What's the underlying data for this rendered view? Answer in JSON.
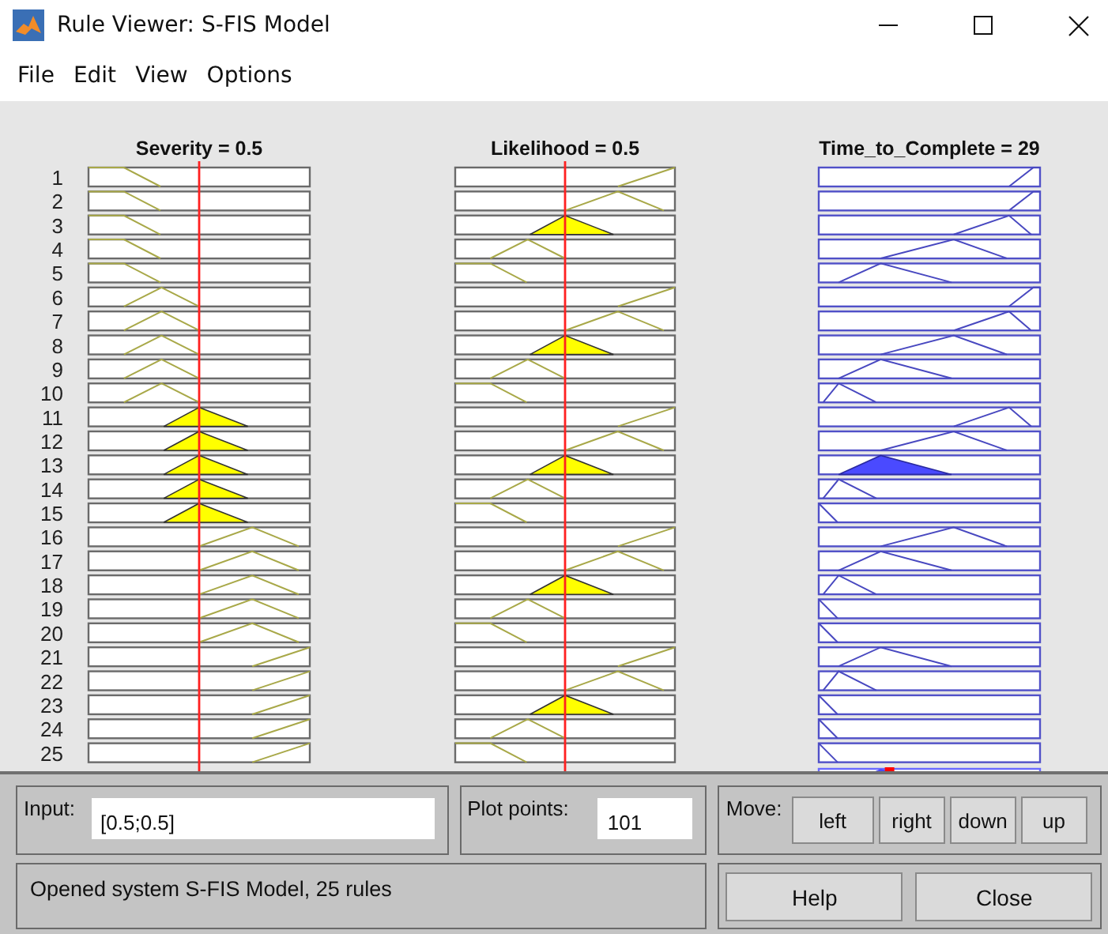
{
  "window": {
    "title": "Rule Viewer: S-FIS Model"
  },
  "menu": [
    "File",
    "Edit",
    "View",
    "Options"
  ],
  "columns": [
    {
      "title": "Severity = 0.5",
      "kind": "input",
      "level": 0.5
    },
    {
      "title": "Likelihood = 0.5",
      "kind": "input",
      "level": 0.5
    },
    {
      "title": "Time_to_Complete = 29",
      "kind": "output",
      "level": 0.32
    }
  ],
  "rules": [
    {
      "number": "1",
      "cells": [
        {
          "kind": "low",
          "fired": false
        },
        {
          "kind": "high",
          "fired": false
        },
        {
          "kind": "vlong",
          "fired": false
        }
      ]
    },
    {
      "number": "2",
      "cells": [
        {
          "kind": "low",
          "fired": false
        },
        {
          "kind": "midhigh",
          "fired": false
        },
        {
          "kind": "vlong",
          "fired": false
        }
      ]
    },
    {
      "number": "3",
      "cells": [
        {
          "kind": "low",
          "fired": false
        },
        {
          "kind": "mid",
          "fired": true
        },
        {
          "kind": "long",
          "fired": false
        }
      ]
    },
    {
      "number": "4",
      "cells": [
        {
          "kind": "low",
          "fired": false
        },
        {
          "kind": "midlow",
          "fired": false
        },
        {
          "kind": "medium",
          "fired": false
        }
      ]
    },
    {
      "number": "5",
      "cells": [
        {
          "kind": "low",
          "fired": false
        },
        {
          "kind": "low",
          "fired": false
        },
        {
          "kind": "short",
          "fired": false
        }
      ]
    },
    {
      "number": "6",
      "cells": [
        {
          "kind": "midlow",
          "fired": false
        },
        {
          "kind": "high",
          "fired": false
        },
        {
          "kind": "vlong",
          "fired": false
        }
      ]
    },
    {
      "number": "7",
      "cells": [
        {
          "kind": "midlow",
          "fired": false
        },
        {
          "kind": "midhigh",
          "fired": false
        },
        {
          "kind": "long",
          "fired": false
        }
      ]
    },
    {
      "number": "8",
      "cells": [
        {
          "kind": "midlow",
          "fired": false
        },
        {
          "kind": "mid",
          "fired": true
        },
        {
          "kind": "medium",
          "fired": false
        }
      ]
    },
    {
      "number": "9",
      "cells": [
        {
          "kind": "midlow",
          "fired": false
        },
        {
          "kind": "midlow",
          "fired": false
        },
        {
          "kind": "short",
          "fired": false
        }
      ]
    },
    {
      "number": "10",
      "cells": [
        {
          "kind": "midlow",
          "fired": false
        },
        {
          "kind": "low",
          "fired": false
        },
        {
          "kind": "vshort",
          "fired": false
        }
      ]
    },
    {
      "number": "11",
      "cells": [
        {
          "kind": "mid",
          "fired": true
        },
        {
          "kind": "high",
          "fired": false
        },
        {
          "kind": "long",
          "fired": false
        }
      ]
    },
    {
      "number": "12",
      "cells": [
        {
          "kind": "mid",
          "fired": true
        },
        {
          "kind": "midhigh",
          "fired": false
        },
        {
          "kind": "medium",
          "fired": false
        }
      ]
    },
    {
      "number": "13",
      "cells": [
        {
          "kind": "mid",
          "fired": true
        },
        {
          "kind": "mid",
          "fired": true
        },
        {
          "kind": "short",
          "fired": true
        }
      ]
    },
    {
      "number": "14",
      "cells": [
        {
          "kind": "mid",
          "fired": true
        },
        {
          "kind": "midlow",
          "fired": false
        },
        {
          "kind": "vshort",
          "fired": false
        }
      ]
    },
    {
      "number": "15",
      "cells": [
        {
          "kind": "mid",
          "fired": true
        },
        {
          "kind": "low",
          "fired": false
        },
        {
          "kind": "edge",
          "fired": false
        }
      ]
    },
    {
      "number": "16",
      "cells": [
        {
          "kind": "midhigh",
          "fired": false
        },
        {
          "kind": "high",
          "fired": false
        },
        {
          "kind": "medium",
          "fired": false
        }
      ]
    },
    {
      "number": "17",
      "cells": [
        {
          "kind": "midhigh",
          "fired": false
        },
        {
          "kind": "midhigh",
          "fired": false
        },
        {
          "kind": "short",
          "fired": false
        }
      ]
    },
    {
      "number": "18",
      "cells": [
        {
          "kind": "midhigh",
          "fired": false
        },
        {
          "kind": "mid",
          "fired": true
        },
        {
          "kind": "vshort",
          "fired": false
        }
      ]
    },
    {
      "number": "19",
      "cells": [
        {
          "kind": "midhigh",
          "fired": false
        },
        {
          "kind": "midlow",
          "fired": false
        },
        {
          "kind": "edge",
          "fired": false
        }
      ]
    },
    {
      "number": "20",
      "cells": [
        {
          "kind": "midhigh",
          "fired": false
        },
        {
          "kind": "low",
          "fired": false
        },
        {
          "kind": "edge",
          "fired": false
        }
      ]
    },
    {
      "number": "21",
      "cells": [
        {
          "kind": "high",
          "fired": false
        },
        {
          "kind": "high",
          "fired": false
        },
        {
          "kind": "short",
          "fired": false
        }
      ]
    },
    {
      "number": "22",
      "cells": [
        {
          "kind": "high",
          "fired": false
        },
        {
          "kind": "midhigh",
          "fired": false
        },
        {
          "kind": "vshort",
          "fired": false
        }
      ]
    },
    {
      "number": "23",
      "cells": [
        {
          "kind": "high",
          "fired": false
        },
        {
          "kind": "mid",
          "fired": true
        },
        {
          "kind": "edge",
          "fired": false
        }
      ]
    },
    {
      "number": "24",
      "cells": [
        {
          "kind": "high",
          "fired": false
        },
        {
          "kind": "midlow",
          "fired": false
        },
        {
          "kind": "edge",
          "fired": false
        }
      ]
    },
    {
      "number": "25",
      "cells": [
        {
          "kind": "high",
          "fired": false
        },
        {
          "kind": "low",
          "fired": false
        },
        {
          "kind": "edge",
          "fired": false
        }
      ]
    }
  ],
  "input": {
    "label": "Input:",
    "value": "[0.5;0.5]"
  },
  "plot_points": {
    "label": "Plot points:",
    "value": "101"
  },
  "move": {
    "label": "Move:",
    "buttons": [
      "left",
      "right",
      "down",
      "up"
    ]
  },
  "status": "Opened system S-FIS Model, 25 rules",
  "buttons": [
    "Help",
    "Close"
  ]
}
